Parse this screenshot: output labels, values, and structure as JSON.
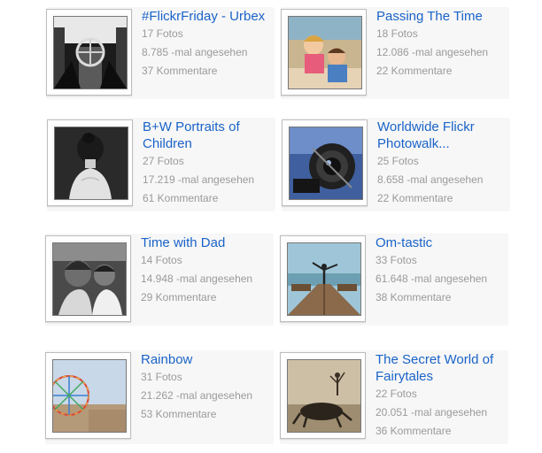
{
  "albums": [
    {
      "title": "#FlickrFriday - Urbex",
      "photos": "17 Fotos",
      "views": "8.785 -mal angesehen",
      "comments": "37 Kommentare",
      "thumb_icon": "urbex-chandelier-photo"
    },
    {
      "title": "Passing The Time",
      "photos": "18 Fotos",
      "views": "12.086 -mal angesehen",
      "comments": "22 Kommentare",
      "thumb_icon": "children-playing-photo"
    },
    {
      "title": "B+W Portraits of Children",
      "photos": "27 Fotos",
      "views": "17.219 -mal angesehen",
      "comments": "61 Kommentare",
      "thumb_icon": "girl-back-portrait-photo"
    },
    {
      "title": "Worldwide Flickr Photowalk...",
      "photos": "25 Fotos",
      "views": "8.658 -mal angesehen",
      "comments": "22 Kommentare",
      "thumb_icon": "camera-lens-photo"
    },
    {
      "title": "Time with Dad",
      "photos": "14 Fotos",
      "views": "14.948 -mal angesehen",
      "comments": "29 Kommentare",
      "thumb_icon": "father-daughter-photo"
    },
    {
      "title": "Om-tastic",
      "photos": "33 Fotos",
      "views": "61.648 -mal angesehen",
      "comments": "38 Kommentare",
      "thumb_icon": "yoga-pier-photo"
    },
    {
      "title": "Rainbow",
      "photos": "31 Fotos",
      "views": "21.262 -mal angesehen",
      "comments": "53 Kommentare",
      "thumb_icon": "ferris-wheel-photo"
    },
    {
      "title": "The Secret World of Fairytales",
      "photos": "22 Fotos",
      "views": "20.051 -mal angesehen",
      "comments": "36 Kommentare",
      "thumb_icon": "fairytale-creature-photo"
    }
  ],
  "colors": {
    "link": "#1a63c8",
    "meta": "#9a9a9a",
    "frame_border": "#bdbdbd",
    "card_bg": "#f7f7f7"
  }
}
